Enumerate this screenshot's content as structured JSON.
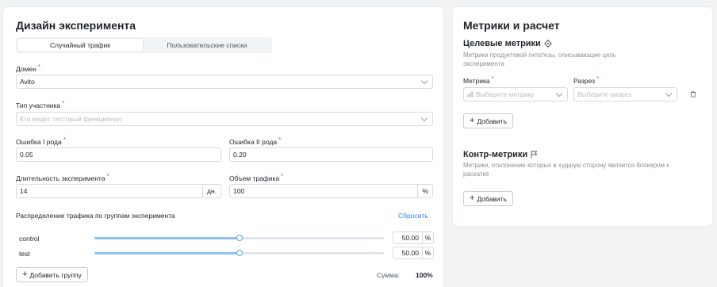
{
  "design": {
    "title": "Дизайн эксперимента",
    "tabs": [
      {
        "label": "Случайный трафик",
        "active": true
      },
      {
        "label": "Пользовательские списки",
        "active": false
      }
    ],
    "domain": {
      "label": "Домен",
      "required": "*",
      "value": "Avito"
    },
    "participant": {
      "label": "Тип участника",
      "required": "*",
      "placeholder": "Кто видит тестовый функционал"
    },
    "error1": {
      "label": "Ошибка I рода",
      "required": "*",
      "value": "0.05"
    },
    "error2": {
      "label": "Ошибка II рода",
      "required": "*",
      "value": "0.20"
    },
    "duration": {
      "label": "Длительность эксперимента",
      "required": "*",
      "value": "14",
      "suffix": "дн."
    },
    "traffic": {
      "label": "Объем трафика",
      "required": "*",
      "value": "100",
      "suffix": "%"
    },
    "distribution": {
      "label": "Распределение трафика по группам эксперимента",
      "reset": "Сбросить",
      "groups": [
        {
          "name": "control",
          "value": "50.00",
          "unit": "%",
          "fraction": 0.5
        },
        {
          "name": "test",
          "value": "50.00",
          "unit": "%",
          "fraction": 0.5
        }
      ]
    },
    "add_group": "Добавить группу",
    "sum_label": "Сумма:",
    "sum_value": "100%"
  },
  "metrics": {
    "title": "Метрики и расчет",
    "target": {
      "title": "Целевые метрики",
      "icon": "target-icon",
      "hint": "Метрики продуктовой гипотезы, описывающие цель эксперимента",
      "metric_label": "Метрика",
      "metric_required": "*",
      "metric_placeholder": "Выберите метрику",
      "cut_label": "Разрез",
      "cut_required": "*",
      "cut_placeholder": "Выберите разрез",
      "add": "Добавить"
    },
    "counter": {
      "title": "Контр-метрики",
      "icon": "flag-icon",
      "hint": "Метрики, отклонение которых в худшую сторону является блокером к раскатке",
      "add": "Добавить"
    }
  },
  "colors": {
    "accent": "#2f7bf5",
    "required": "#e34d59",
    "slider": "#8fc1f4"
  }
}
